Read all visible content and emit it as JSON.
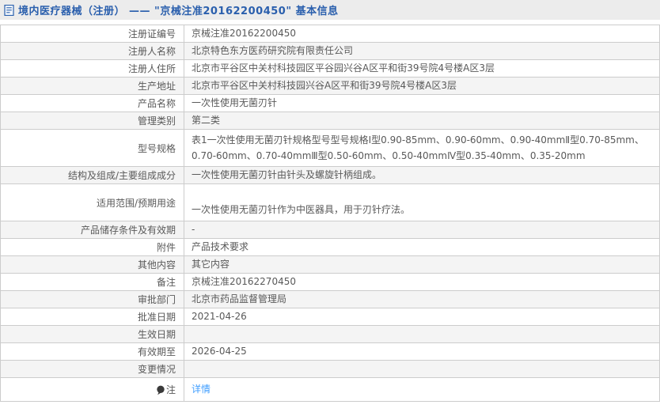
{
  "header": {
    "title": "境内医疗器械（注册） —— \"京械注准20162200450\" 基本信息",
    "icon": "document-icon"
  },
  "table": {
    "rows": [
      {
        "label": "注册证编号",
        "value": "京械注准20162200450"
      },
      {
        "label": "注册人名称",
        "value": "北京特色东方医药研究院有限责任公司"
      },
      {
        "label": "注册人住所",
        "value": "北京市平谷区中关村科技园区平谷园兴谷A区平和街39号院4号楼A区3层"
      },
      {
        "label": "生产地址",
        "value": "北京市平谷区中关村科技园兴谷A区平和街39号院4号楼A区3层"
      },
      {
        "label": "产品名称",
        "value": "一次性使用无菌刃针"
      },
      {
        "label": "管理类别",
        "value": "第二类"
      },
      {
        "label": "型号规格",
        "value": "表1一次性使用无菌刃针规格型号型号规格Ⅰ型0.90-85mm、0.90-60mm、0.90-40mmⅡ型0.70-85mm、0.70-60mm、0.70-40mmⅢ型0.50-60mm、0.50-40mmⅣ型0.35-40mm、0.35-20mm"
      },
      {
        "label": "结构及组成/主要组成成分",
        "value": "一次性使用无菌刃针由针头及螺旋针柄组成。"
      },
      {
        "label": "适用范围/预期用途",
        "value": "\n一次性使用无菌刃针作为中医器具，用于刃针疗法。"
      },
      {
        "label": "产品储存条件及有效期",
        "value": "-"
      },
      {
        "label": "附件",
        "value": "产品技术要求"
      },
      {
        "label": "其他内容",
        "value": "其它内容"
      },
      {
        "label": "备注",
        "value": "京械注准20162270450"
      },
      {
        "label": "审批部门",
        "value": "北京市药品监督管理局"
      },
      {
        "label": "批准日期",
        "value": "2021-04-26"
      },
      {
        "label": "生效日期",
        "value": ""
      },
      {
        "label": "有效期至",
        "value": "2026-04-25"
      },
      {
        "label": "变更情况",
        "value": ""
      },
      {
        "label": "注",
        "link_label": "详情",
        "icon": "comment-bubble-icon"
      }
    ]
  },
  "colors": {
    "header_text": "#2a5fad",
    "link": "#409eff",
    "row_alt_bg": "#f4f4f4",
    "border": "#cccccc",
    "header_bar_bg": "#ececec"
  }
}
